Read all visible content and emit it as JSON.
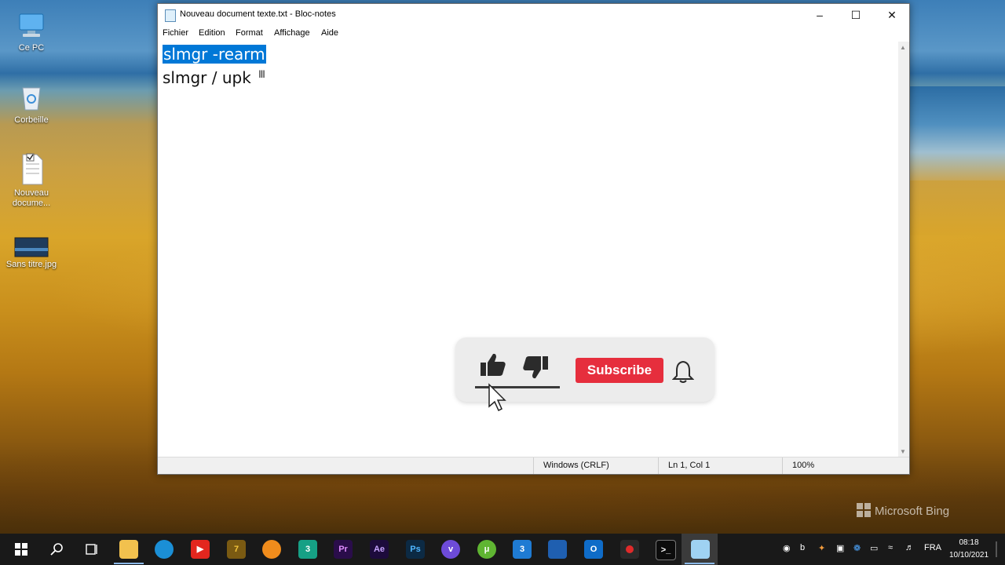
{
  "desktop": {
    "icons": [
      {
        "label": "Ce PC"
      },
      {
        "label": "Corbeille"
      },
      {
        "label": "Nouveau docume..."
      },
      {
        "label": "Sans titre.jpg"
      }
    ]
  },
  "notepad": {
    "title": "Nouveau document texte.txt - Bloc-notes",
    "menu": [
      "Fichier",
      "Edition",
      "Format",
      "Affichage",
      "Aide"
    ],
    "lines": [
      "slmgr -rearm",
      "slmgr / upk"
    ],
    "selected_line_index": 0,
    "status": {
      "encoding": "Windows (CRLF)",
      "position": "Ln 1, Col 1",
      "zoom": "100%"
    }
  },
  "overlay": {
    "subscribe_label": "Subscribe"
  },
  "watermark": {
    "text": "Microsoft Bing"
  },
  "taskbar": {
    "apps": [
      "start-icon",
      "search-icon",
      "task-view-icon",
      "file-explorer-icon",
      "edge-icon",
      "youtube-icon",
      "7zip-icon",
      "fl-studio-icon",
      "app-3-icon",
      "premiere-pro-icon",
      "after-effects-icon",
      "photoshop-icon",
      "viber-icon",
      "utorrent-icon",
      "css3-icon",
      "teams-icon",
      "outlook-icon",
      "record-icon",
      "terminal-icon",
      "notepad-icon"
    ],
    "language": "FRA",
    "time": "08:18",
    "date": "10/10/2021"
  },
  "colors": {
    "selection": "#0078d7",
    "subscribe": "#e62e3d",
    "taskbar": "#191919"
  }
}
